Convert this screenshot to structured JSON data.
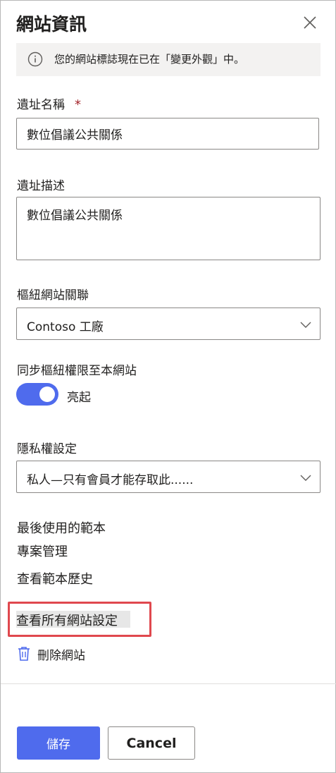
{
  "panel": {
    "title": "網站資訊"
  },
  "info_bar": {
    "icon": "info-icon",
    "message": "您的網站標誌現在已在「變更外觀」中。"
  },
  "site_name": {
    "label": "遺址名稱",
    "required_marker": "*",
    "value": "數位倡議公共關係"
  },
  "site_description": {
    "label": "遺址描述",
    "value": "數位倡議公共關係"
  },
  "hub_association": {
    "label": "樞紐網站關聯",
    "selected": "Contoso 工廠"
  },
  "sync_permissions": {
    "label": "同步樞紐權限至本網站",
    "toggle_state": "亮起",
    "enabled": true
  },
  "privacy": {
    "label": "隱私權設定",
    "selected": "私人—只有會員才能存取此......"
  },
  "template": {
    "heading": "最後使用的範本",
    "name": "專案管理",
    "history_link": "查看範本歷史"
  },
  "all_settings_link": "查看所有網站設定",
  "delete_site": {
    "icon": "trash-icon",
    "label": "刪除網站"
  },
  "footer": {
    "save_label": "儲存",
    "cancel_label": "Cancel"
  },
  "colors": {
    "accent": "#4f6bed",
    "highlight_border": "#e0484e",
    "required": "#a4262c"
  }
}
